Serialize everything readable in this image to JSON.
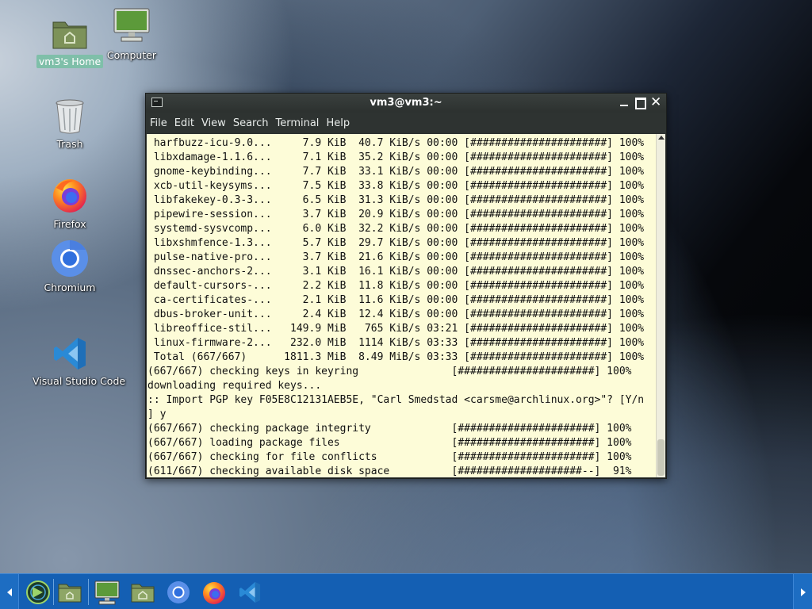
{
  "desktop": {
    "icons": [
      {
        "label": "vm3's Home",
        "icon": "home-folder-icon",
        "selected": true
      },
      {
        "label": "Computer",
        "icon": "computer-icon"
      },
      {
        "label": "Trash",
        "icon": "trash-icon"
      },
      {
        "label": "Firefox",
        "icon": "firefox-icon"
      },
      {
        "label": "Chromium",
        "icon": "chromium-icon"
      },
      {
        "label": "Visual Studio Code",
        "icon": "vscode-icon"
      }
    ]
  },
  "terminal": {
    "title": "vm3@vm3:~",
    "menu": [
      "File",
      "Edit",
      "View",
      "Search",
      "Terminal",
      "Help"
    ],
    "lines": [
      " harfbuzz-icu-9.0...     7.9 KiB  40.7 KiB/s 00:00 [######################] 100%",
      " libxdamage-1.1.6...     7.1 KiB  35.2 KiB/s 00:00 [######################] 100%",
      " gnome-keybinding...     7.7 KiB  33.1 KiB/s 00:00 [######################] 100%",
      " xcb-util-keysyms...     7.5 KiB  33.8 KiB/s 00:00 [######################] 100%",
      " libfakekey-0.3-3...     6.5 KiB  31.3 KiB/s 00:00 [######################] 100%",
      " pipewire-session...     3.7 KiB  20.9 KiB/s 00:00 [######################] 100%",
      " systemd-sysvcomp...     6.0 KiB  32.2 KiB/s 00:00 [######################] 100%",
      " libxshmfence-1.3...     5.7 KiB  29.7 KiB/s 00:00 [######################] 100%",
      " pulse-native-pro...     3.7 KiB  21.6 KiB/s 00:00 [######################] 100%",
      " dnssec-anchors-2...     3.1 KiB  16.1 KiB/s 00:00 [######################] 100%",
      " default-cursors-...     2.2 KiB  11.8 KiB/s 00:00 [######################] 100%",
      " ca-certificates-...     2.1 KiB  11.6 KiB/s 00:00 [######################] 100%",
      " dbus-broker-unit...     2.4 KiB  12.4 KiB/s 00:00 [######################] 100%",
      " libreoffice-stil...   149.9 MiB   765 KiB/s 03:21 [######################] 100%",
      " linux-firmware-2...   232.0 MiB  1114 KiB/s 03:33 [######################] 100%",
      " Total (667/667)      1811.3 MiB  8.49 MiB/s 03:33 [######################] 100%",
      "(667/667) checking keys in keyring               [######################] 100%",
      "downloading required keys...",
      ":: Import PGP key F05E8C12131AEB5E, \"Carl Smedstad <carsme@archlinux.org>\"? [Y/n",
      "] y",
      "(667/667) checking package integrity             [######################] 100%",
      "(667/667) loading package files                  [######################] 100%",
      "(667/667) checking for file conflicts            [######################] 100%",
      "(611/667) checking available disk space          [####################--]  91%"
    ]
  },
  "taskbar": {
    "items": [
      "menu-icon",
      "files-icon",
      "computer-icon",
      "home-folder-icon",
      "chromium-icon",
      "firefox-icon",
      "vscode-icon"
    ]
  }
}
